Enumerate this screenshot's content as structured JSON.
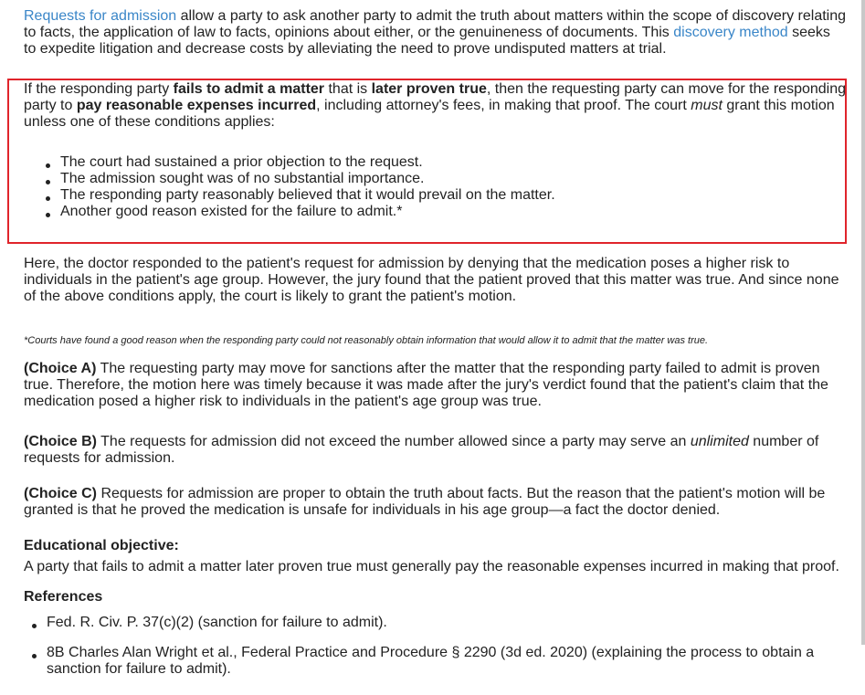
{
  "intro": {
    "link1": "Requests for admission",
    "text1": " allow a party to ask another party to admit the truth about matters within the scope of discovery relating to facts, the application of law to facts, opinions about either, or the genuineness of documents.  This ",
    "link2": "discovery method",
    "text2": " seeks to expedite litigation and decrease costs by alleviating the need to prove undisputed matters at trial."
  },
  "box": {
    "t1": "If the responding party ",
    "b1": "fails to admit a matter",
    "t2": " that is ",
    "b2": "later proven true",
    "t3": ", then the requesting party can move for the responding party to ",
    "b3": "pay reasonable expenses incurred",
    "t4": ", including attorney's fees, in making that proof.  The court ",
    "i1": "must",
    "t5": " grant this motion unless one of these conditions applies:",
    "bullets": [
      "The court had sustained a prior objection to the request.",
      "The admission sought was of no substantial importance.",
      "The responding party reasonably believed that it would prevail on the matter.",
      "Another good reason existed for the failure to admit.*"
    ]
  },
  "here": "Here, the doctor responded to the patient's request for admission by denying that the medication poses a higher risk to individuals in the patient's age group.  However, the jury found that the patient proved that this matter was true.  And since none of the above conditions apply, the court is likely to grant the patient's motion.",
  "footnote": "*Courts have found a good reason when the responding party could not reasonably obtain information that would allow it to admit that the matter was true.",
  "choiceA": {
    "label": "(Choice A)",
    "text": "  The requesting party may move for sanctions after the matter that the responding party failed to admit is proven true.  Therefore, the motion here was timely because it was made after the jury's verdict found that the patient's claim that the medication posed a higher risk to individuals in the patient's age group was true."
  },
  "choiceB": {
    "label": "(Choice B)",
    "t1": "  The requests for admission did not exceed the number allowed since a party may serve an ",
    "i1": "unlimited",
    "t2": " number of requests for admission."
  },
  "choiceC": {
    "label": "(Choice C)",
    "text": "  Requests for admission are proper to obtain the truth about facts.  But the reason that the patient's motion will be granted is that he proved the medication is unsafe for individuals in his age group—a fact the doctor denied."
  },
  "educational": {
    "heading": "Educational objective:",
    "text": "A party that fails to admit a matter later proven true must generally pay the reasonable expenses incurred in making that proof."
  },
  "references": {
    "heading": "References",
    "items": [
      "Fed. R. Civ. P. 37(c)(2) (sanction for failure to admit).",
      "8B Charles Alan Wright et al., Federal Practice and Procedure § 2290 (3d ed. 2020) (explaining the process to obtain a sanction for failure to admit)."
    ]
  }
}
